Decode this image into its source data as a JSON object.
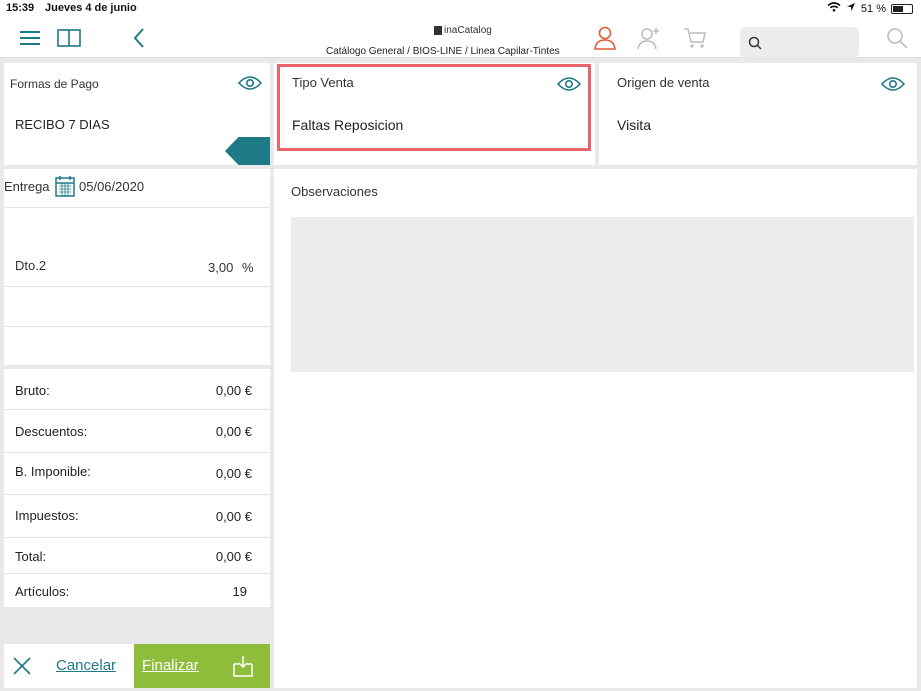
{
  "status_bar": {
    "time": "15:39",
    "date": "Jueves 4 de junio",
    "battery": "51 %",
    "battery_level": 0.51
  },
  "toolbar": {
    "logo_text": "inaCatalog",
    "breadcrumb": "Catálogo General / BIOS-LINE / Linea Capilar-Tintes",
    "search_placeholder": "",
    "colors": {
      "accent": "#1e7a86",
      "user_icon": "#e15b3a",
      "finalizar": "#8dbd3a",
      "highlight": "#e8636a"
    }
  },
  "payment": {
    "label": "Formas de Pago",
    "value": "RECIBO 7 DIAS"
  },
  "sale_type": {
    "label": "Tipo Venta",
    "value": "Faltas Reposicion"
  },
  "origin": {
    "label": "Origen de venta",
    "value": "Visita"
  },
  "delivery": {
    "label": "Entrega",
    "date": "05/06/2020"
  },
  "discount": {
    "label": "Dto.2",
    "value": "3,00",
    "unit": "%"
  },
  "observations": {
    "label": "Observaciones"
  },
  "totals": [
    {
      "label": "Bruto:",
      "value": "0,00 €"
    },
    {
      "label": "Descuentos:",
      "value": "0,00 €"
    },
    {
      "label": "B. Imponible:",
      "value": "0,00 €"
    },
    {
      "label": "Impuestos:",
      "value": "0,00 €"
    },
    {
      "label": "Total:",
      "value": "0,00 €"
    },
    {
      "label": "Artículos:",
      "value": "19"
    }
  ],
  "actions": {
    "cancel": "Cancelar",
    "finish": "Finalizar"
  }
}
